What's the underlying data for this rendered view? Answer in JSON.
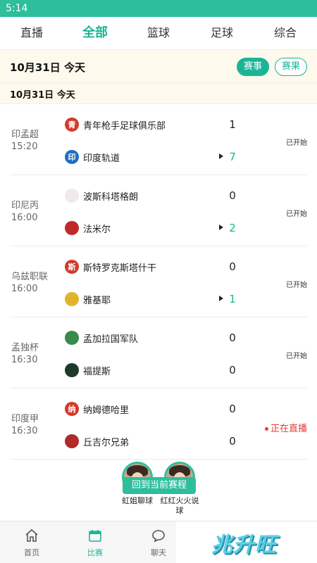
{
  "status_bar": {
    "time": "5:14"
  },
  "tabs": [
    {
      "label": "直播"
    },
    {
      "label": "全部"
    },
    {
      "label": "篮球"
    },
    {
      "label": "足球"
    },
    {
      "label": "综合"
    }
  ],
  "active_tab": "全部",
  "date_header": {
    "date": "10月31日 今天",
    "btn_events": "赛事",
    "btn_results": "赛果"
  },
  "section_date": "10月31日   今天",
  "matches": [
    {
      "league": "印孟超",
      "time": "15:20",
      "home": {
        "name": "青年枪手足球俱乐部",
        "logo": "青",
        "color": "#d23a2a",
        "score": "1"
      },
      "away": {
        "name": "印度轨道",
        "logo": "印",
        "color": "#1e6fc4",
        "score": "7"
      },
      "status": "已开始"
    },
    {
      "league": "印尼丙",
      "time": "16:00",
      "home": {
        "name": "波斯科塔格朗",
        "logo": "",
        "color": "#f2e9ea",
        "score": "0"
      },
      "away": {
        "name": "法米尔",
        "logo": "",
        "color": "#c0282a",
        "score": "2"
      },
      "status": "已开始"
    },
    {
      "league": "乌兹职联",
      "time": "16:00",
      "home": {
        "name": "斯特罗克斯塔什干",
        "logo": "斯",
        "color": "#d23a2a",
        "score": "0"
      },
      "away": {
        "name": "雅基耶",
        "logo": "",
        "color": "#e0b52a",
        "score": "1"
      },
      "status": "已开始"
    },
    {
      "league": "孟独杯",
      "time": "16:30",
      "home": {
        "name": "孟加拉国军队",
        "logo": "",
        "color": "#3a8a4a",
        "score": "0"
      },
      "away": {
        "name": "福提斯",
        "logo": "",
        "color": "#1f3a2a",
        "score": "0"
      },
      "status": "已开始"
    },
    {
      "league": "印度甲",
      "time": "16:30",
      "home": {
        "name": "纳姆德哈里",
        "logo": "纳",
        "color": "#d23a2a",
        "score": "0"
      },
      "away": {
        "name": "丘吉尔兄弟",
        "logo": "",
        "color": "#b02a2a",
        "score": "0"
      },
      "status": "正在直播"
    }
  ],
  "floating": {
    "back_label": "回到当前赛程",
    "anchor1": "虹姐聊球",
    "anchor2": "红红火火说球"
  },
  "bottom_nav": {
    "items": [
      {
        "label": "首页",
        "icon": "home-icon"
      },
      {
        "label": "比赛",
        "icon": "calendar-icon"
      },
      {
        "label": "聊天",
        "icon": "chat-icon"
      }
    ],
    "active": "比赛",
    "brand": "兆升旺"
  },
  "colors": {
    "accent": "#1bb596",
    "statusbar": "#2dbe9c",
    "live": "#e53935",
    "date_bg": "#fdf9ec"
  }
}
